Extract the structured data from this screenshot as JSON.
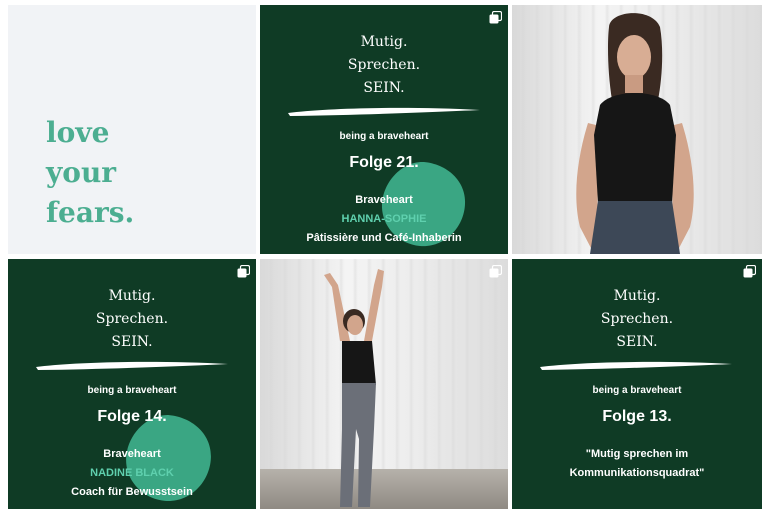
{
  "tile_love": {
    "lines": [
      "love",
      "your",
      "fears."
    ],
    "color": "#4cae91"
  },
  "posts": [
    {
      "headline": [
        "Mutig.",
        "Sprechen.",
        "SEIN."
      ],
      "tagline": "being a braveheart",
      "episode": "Folge 21.",
      "guest_line1_prefix": "Braveheart",
      "guest_line1_name": "HANNA-SOPHIE",
      "guest_line2": "Pâtissière und Café-Inhaberin",
      "multi_icon": "multiple-posts-icon"
    },
    {
      "headline": [
        "Mutig.",
        "Sprechen.",
        "SEIN."
      ],
      "tagline": "being a braveheart",
      "episode": "Folge 14.",
      "guest_line1_prefix": "Braveheart",
      "guest_line1_name": "NADINE BLACK",
      "guest_line2": "Coach für Bewusstsein",
      "multi_icon": "multiple-posts-icon"
    },
    {
      "headline": [
        "Mutig.",
        "Sprechen.",
        "SEIN."
      ],
      "tagline": "being a braveheart",
      "episode": "Folge 13.",
      "guest_line1": "\"Mutig sprechen im",
      "guest_line2": "Kommunikationsquadrat\"",
      "multi_icon": "multiple-posts-icon"
    }
  ],
  "photos": [
    {
      "subject": "woman-portrait-photo",
      "multi_icon": "none"
    },
    {
      "subject": "woman-arms-raised-photo",
      "multi_icon": "multiple-posts-icon"
    }
  ],
  "colors": {
    "dark_green": "#0f3b25",
    "accent_green": "#4cae91",
    "blob_green": "#3aa683",
    "highlight": "#5fd0ae"
  }
}
